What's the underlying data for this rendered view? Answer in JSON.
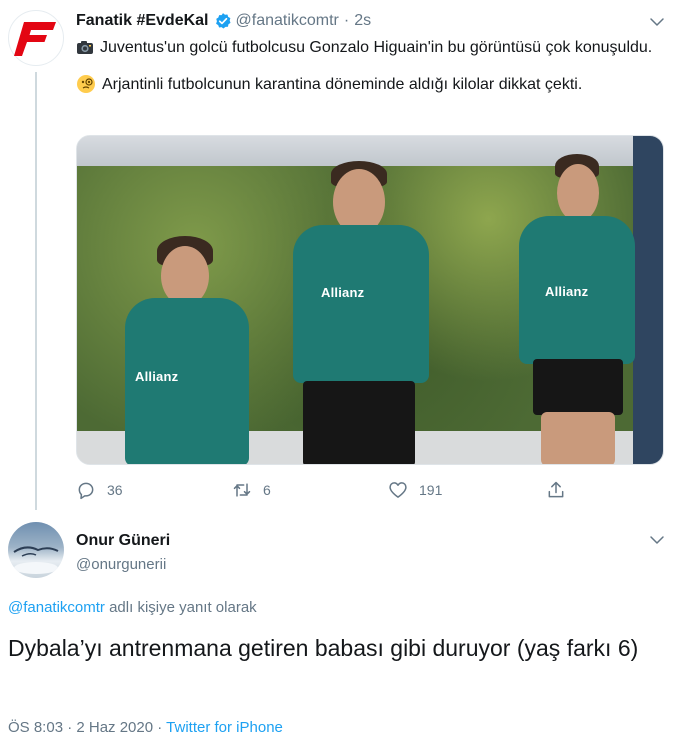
{
  "parent_tweet": {
    "display_name": "Fanatik #EvdeKal",
    "handle": "@fanatikcomtr",
    "separator": "·",
    "time": "2s",
    "text_line1": "Juventus'un golcü futbolcusu Gonzalo Higuain'in bu görüntüsü çok konuşuldu.",
    "text_line2": "Arjantinli futbolcunun karantina döneminde aldığı kilolar dikkat çekti.",
    "media_sponsor_text": "Allianz",
    "actions": {
      "reply_count": "36",
      "retweet_count": "6",
      "like_count": "191"
    }
  },
  "reply_tweet": {
    "display_name": "Onur Güneri",
    "handle": "@onurgunerii",
    "reply_mention": "@fanatikcomtr",
    "reply_suffix": " adlı kişiye yanıt olarak",
    "text": "Dybala’yı antrenmana getiren babası gibi duruyor (yaş farkı 6)",
    "timestamp": "ÖS 8:03 · 2 Haz 2020",
    "separator": " · ",
    "source": "Twitter for iPhone"
  },
  "colors": {
    "accent": "#1da1f2",
    "secondary_text": "#657786",
    "brand_red": "#e30613"
  },
  "icons": [
    "fanatik-logo-icon",
    "verified-badge-icon",
    "chevron-down-icon",
    "camera-emoji-icon",
    "monocle-face-emoji-icon",
    "reply-icon",
    "retweet-icon",
    "like-icon",
    "share-icon"
  ]
}
